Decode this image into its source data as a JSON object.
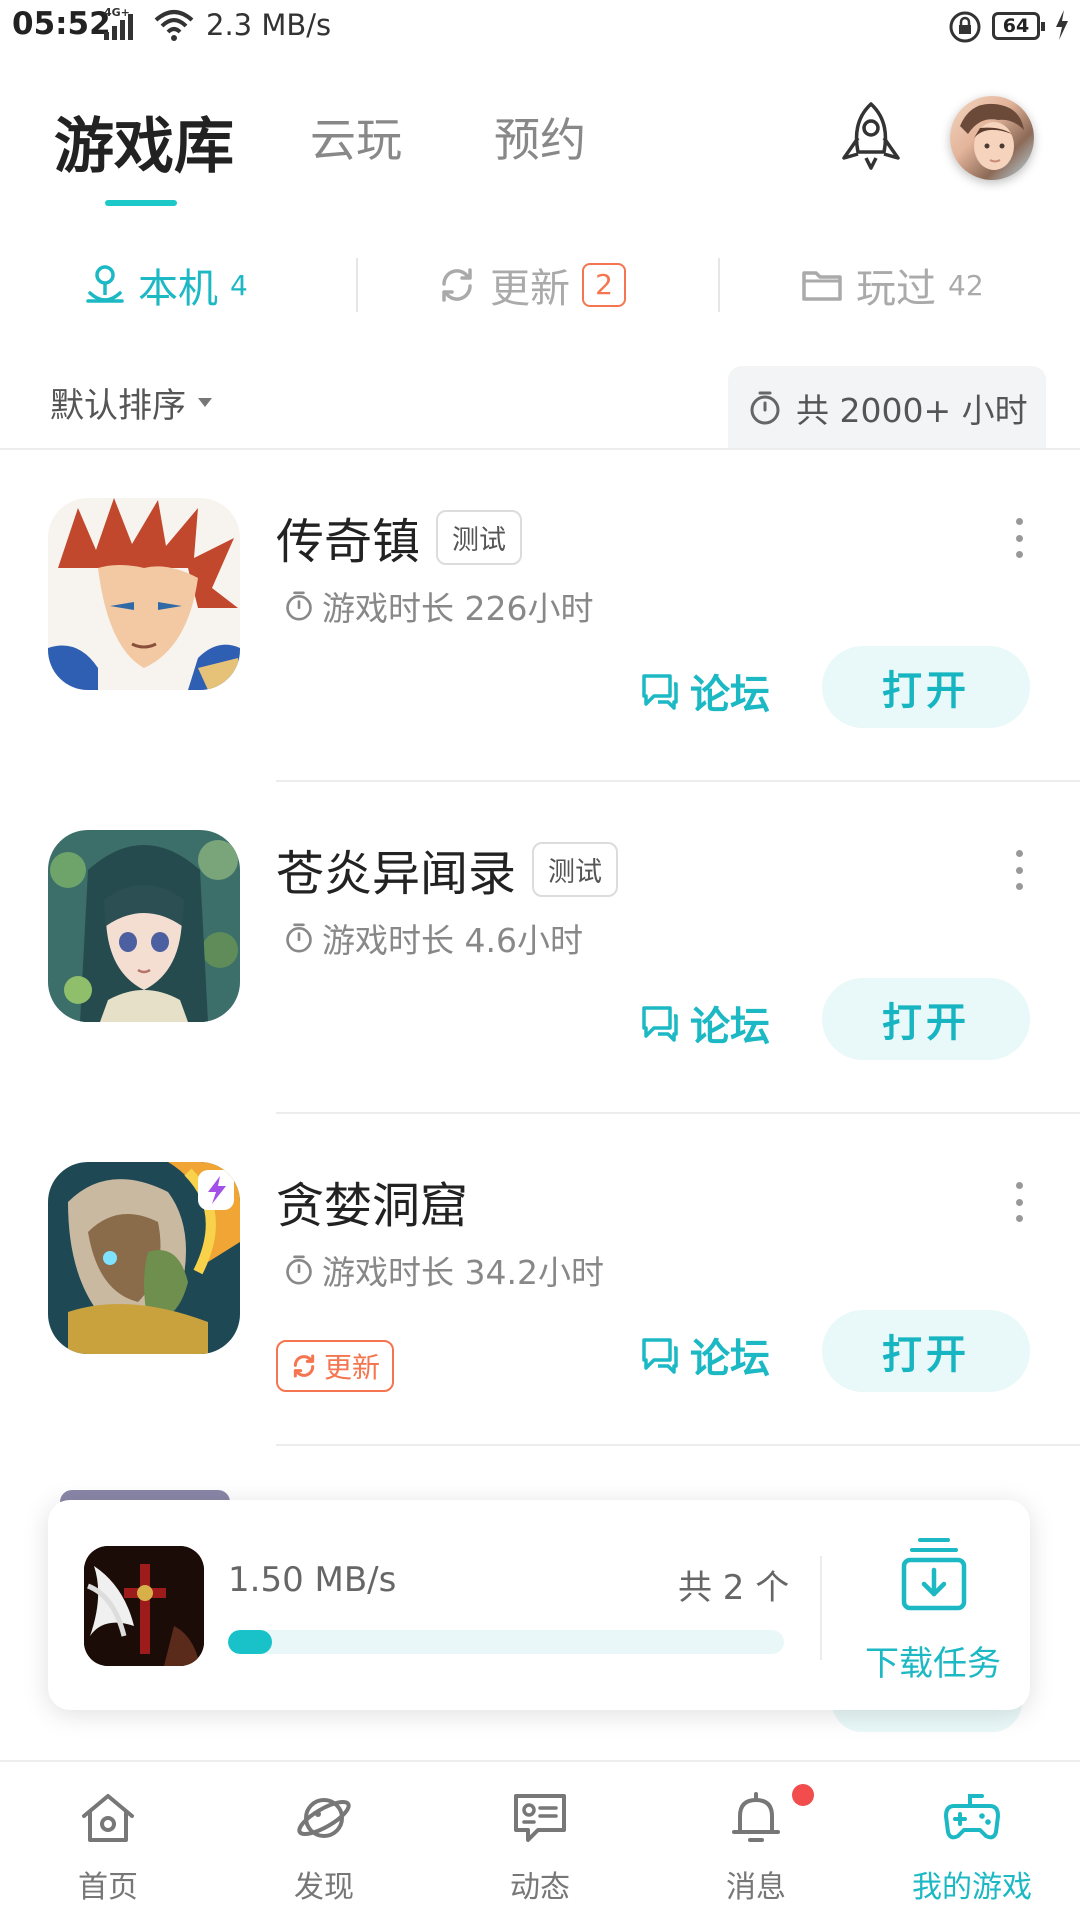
{
  "status_bar": {
    "time": "05:52",
    "network": "4G+",
    "speed": "2.3 MB/s",
    "battery": "64"
  },
  "top_tabs": [
    "游戏库",
    "云玩",
    "预约"
  ],
  "sub_tabs": [
    {
      "label": "本机",
      "count": "4",
      "icon": "controller-person-icon"
    },
    {
      "label": "更新",
      "count": "2",
      "icon": "refresh-icon"
    },
    {
      "label": "玩过",
      "count": "42",
      "icon": "folder-icon"
    }
  ],
  "sort": {
    "label": "默认排序"
  },
  "total_play_time": "共 2000+ 小时",
  "games": [
    {
      "title": "传奇镇",
      "tag": "测试",
      "play_time": "游戏时长 226小时",
      "forum_label": "论坛",
      "open_label": "打开",
      "update_label": ""
    },
    {
      "title": "苍炎异闻录",
      "tag": "测试",
      "play_time": "游戏时长 4.6小时",
      "forum_label": "论坛",
      "open_label": "打开",
      "update_label": ""
    },
    {
      "title": "贪婪洞窟",
      "tag": "",
      "play_time": "游戏时长 34.2小时",
      "forum_label": "论坛",
      "open_label": "打开",
      "update_label": "更新"
    }
  ],
  "download": {
    "speed": "1.50 MB/s",
    "total": "共 2 个",
    "progress": 0.08,
    "button_label": "下载任务"
  },
  "bottom_nav": [
    {
      "label": "首页",
      "icon": "home-icon"
    },
    {
      "label": "发现",
      "icon": "planet-icon"
    },
    {
      "label": "动态",
      "icon": "feed-icon"
    },
    {
      "label": "消息",
      "icon": "bell-icon"
    },
    {
      "label": "我的游戏",
      "icon": "gamepad-icon"
    }
  ],
  "colors": {
    "accent": "#1cb8c4",
    "update": "#f4754f",
    "notification": "#f24c4c"
  }
}
